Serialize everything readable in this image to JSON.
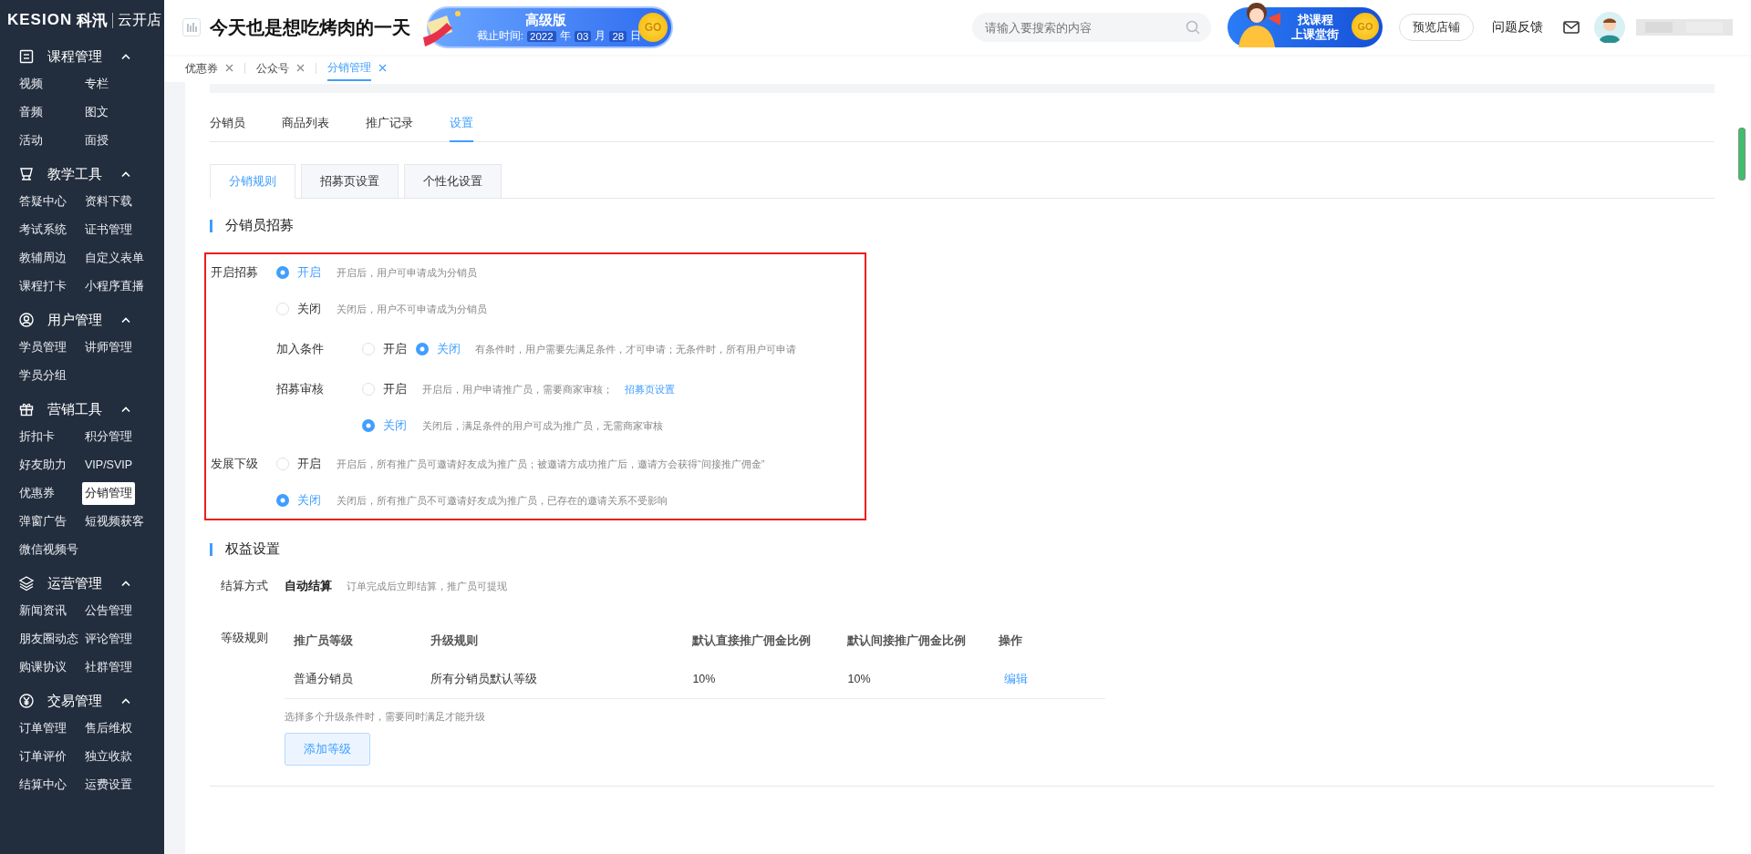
{
  "sidebar": {
    "logo": {
      "brand": "KESION",
      "brand_cn": "科汛",
      "store": "云开店"
    },
    "groups": [
      {
        "title": "课程管理",
        "expanded": true,
        "items": [
          {
            "label": "视频",
            "selected": false
          },
          {
            "label": "专栏",
            "selected": false
          },
          {
            "label": "音频",
            "selected": false
          },
          {
            "label": "图文",
            "selected": false
          },
          {
            "label": "活动",
            "selected": false
          },
          {
            "label": "面授",
            "selected": false
          }
        ]
      },
      {
        "title": "教学工具",
        "expanded": true,
        "items": [
          {
            "label": "答疑中心",
            "selected": false
          },
          {
            "label": "资料下载",
            "selected": false
          },
          {
            "label": "考试系统",
            "selected": false
          },
          {
            "label": "证书管理",
            "selected": false
          },
          {
            "label": "教辅周边",
            "selected": false
          },
          {
            "label": "自定义表单",
            "selected": false
          },
          {
            "label": "课程打卡",
            "selected": false
          },
          {
            "label": "小程序直播",
            "selected": false
          }
        ]
      },
      {
        "title": "用户管理",
        "expanded": true,
        "items": [
          {
            "label": "学员管理",
            "selected": false
          },
          {
            "label": "讲师管理",
            "selected": false
          },
          {
            "label": "学员分组",
            "selected": false
          }
        ]
      },
      {
        "title": "营销工具",
        "expanded": true,
        "items": [
          {
            "label": "折扣卡",
            "selected": false
          },
          {
            "label": "积分管理",
            "selected": false
          },
          {
            "label": "好友助力",
            "selected": false
          },
          {
            "label": "VIP/SVIP",
            "selected": false
          },
          {
            "label": "优惠券",
            "selected": false
          },
          {
            "label": "分销管理",
            "selected": true
          },
          {
            "label": "弹窗广告",
            "selected": false
          },
          {
            "label": "短视频获客",
            "selected": false
          },
          {
            "label": "微信视频号",
            "selected": false
          }
        ]
      },
      {
        "title": "运营管理",
        "expanded": true,
        "items": [
          {
            "label": "新闻资讯",
            "selected": false
          },
          {
            "label": "公告管理",
            "selected": false
          },
          {
            "label": "朋友圈动态",
            "selected": false
          },
          {
            "label": "评论管理",
            "selected": false
          },
          {
            "label": "购课协议",
            "selected": false
          },
          {
            "label": "社群管理",
            "selected": false
          }
        ]
      },
      {
        "title": "交易管理",
        "expanded": true,
        "items": [
          {
            "label": "订单管理",
            "selected": false
          },
          {
            "label": "售后维权",
            "selected": false
          },
          {
            "label": "订单评价",
            "selected": false
          },
          {
            "label": "独立收款",
            "selected": false
          },
          {
            "label": "结算中心",
            "selected": false
          },
          {
            "label": "运费设置",
            "selected": false
          }
        ]
      }
    ]
  },
  "header": {
    "title": "今天也是想吃烤肉的一天",
    "promo": {
      "edition": "高级版",
      "deadline_label": "截止时间:",
      "year": "2022",
      "year_unit": "年",
      "month": "03",
      "month_unit": "月",
      "day": "28",
      "day_unit": "日",
      "go": "GO"
    },
    "search": {
      "placeholder": "请输入要搜索的内容"
    },
    "ad": {
      "line1": "找课程",
      "line2": "上课堂街",
      "go": "GO"
    },
    "preview_button": "预览店铺",
    "feedback": "问题反馈"
  },
  "open_tabs": [
    {
      "label": "优惠券",
      "selected": false
    },
    {
      "label": "公众号",
      "selected": false
    },
    {
      "label": "分销管理",
      "selected": true
    }
  ],
  "page_tabs": [
    {
      "label": "分销员",
      "selected": false
    },
    {
      "label": "商品列表",
      "selected": false
    },
    {
      "label": "推广记录",
      "selected": false
    },
    {
      "label": "设置",
      "selected": true
    }
  ],
  "sub_tabs": [
    {
      "label": "分销规则",
      "selected": true
    },
    {
      "label": "招募页设置",
      "selected": false
    },
    {
      "label": "个性化设置",
      "selected": false
    }
  ],
  "recruit": {
    "title": "分销员招募",
    "highlighted": true,
    "settings": [
      {
        "label": "开启招募",
        "kind": "stacked",
        "options": [
          {
            "label": "开启",
            "selected": true,
            "desc": "开启后，用户可申请成为分销员"
          },
          {
            "label": "关闭",
            "selected": false,
            "desc": "关闭后，用户不可申请成为分销员"
          }
        ],
        "children": [
          {
            "label": "加入条件",
            "kind": "inline",
            "options": [
              {
                "label": "开启",
                "selected": false
              },
              {
                "label": "关闭",
                "selected": true
              }
            ],
            "desc": "有条件时，用户需要先满足条件，才可申请；无条件时，所有用户可申请"
          },
          {
            "label": "招募审核",
            "kind": "stacked",
            "options": [
              {
                "label": "开启",
                "selected": false,
                "desc": "开启后，用户申请推广员，需要商家审核；",
                "link": "招募页设置"
              },
              {
                "label": "关闭",
                "selected": true,
                "desc": "关闭后，满足条件的用户可成为推广员，无需商家审核"
              }
            ]
          }
        ]
      },
      {
        "label": "发展下级",
        "kind": "stacked",
        "options": [
          {
            "label": "开启",
            "selected": false,
            "desc": "开启后，所有推广员可邀请好友成为推广员；被邀请方成功推广后，邀请方会获得“间接推广佣金”"
          },
          {
            "label": "关闭",
            "selected": true,
            "desc": "关闭后，所有推广员不可邀请好友成为推广员，已存在的邀请关系不受影响"
          }
        ]
      }
    ]
  },
  "benefits": {
    "title": "权益设置",
    "settlement": {
      "label": "结算方式",
      "value": "自动结算",
      "desc": "订单完成后立即结算，推广员可提现"
    },
    "levels": {
      "label": "等级规则",
      "columns": [
        "推广员等级",
        "升级规则",
        "默认直接推广佣金比例",
        "默认间接推广佣金比例",
        "操作"
      ],
      "rows": [
        {
          "cells": [
            "普通分销员",
            "所有分销员默认等级",
            "10%",
            "10%"
          ],
          "action": "编辑"
        }
      ],
      "note": "选择多个升级条件时，需要同时满足才能升级",
      "add_button": "添加等级"
    }
  }
}
